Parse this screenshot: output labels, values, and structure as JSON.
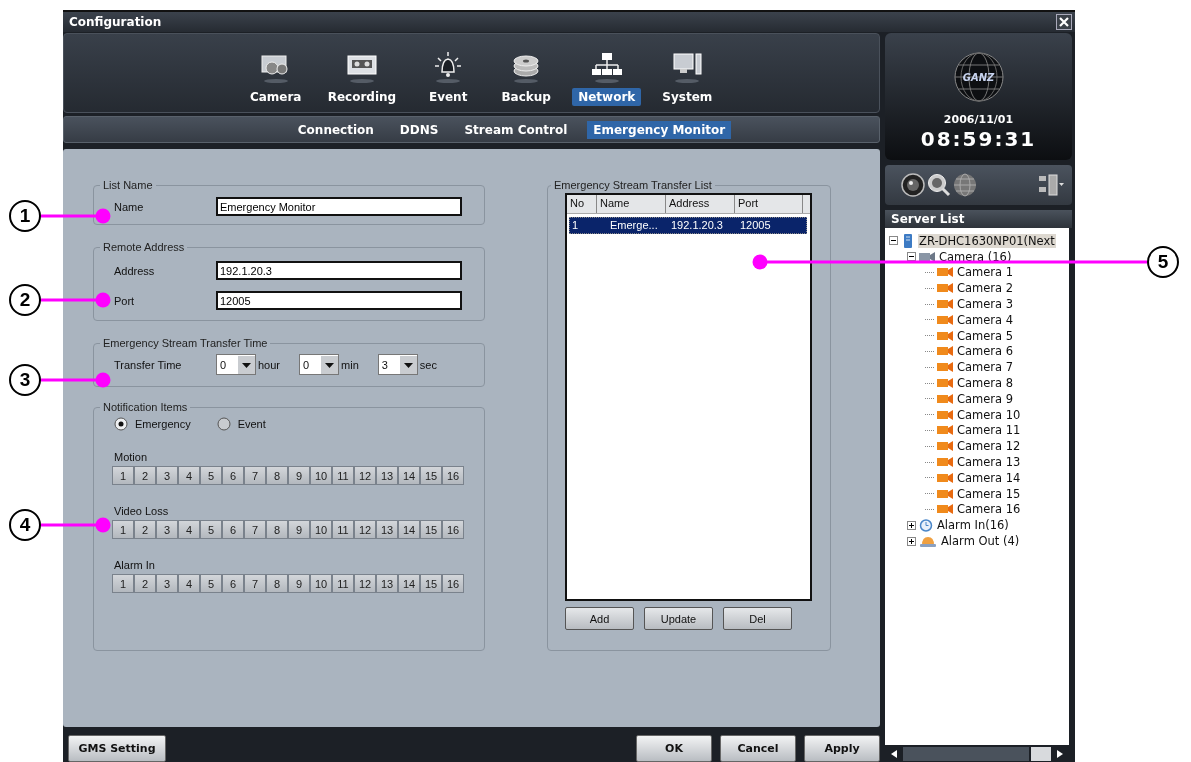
{
  "window": {
    "title": "Configuration"
  },
  "main_tabs": [
    {
      "label": "Camera",
      "selected": false
    },
    {
      "label": "Recording",
      "selected": false
    },
    {
      "label": "Event",
      "selected": false
    },
    {
      "label": "Backup",
      "selected": false
    },
    {
      "label": "Network",
      "selected": true
    },
    {
      "label": "System",
      "selected": false
    }
  ],
  "sub_tabs": [
    {
      "label": "Connection",
      "selected": false
    },
    {
      "label": "DDNS",
      "selected": false
    },
    {
      "label": "Stream Control",
      "selected": false
    },
    {
      "label": "Emergency Monitor",
      "selected": true
    }
  ],
  "list_name": {
    "legend": "List Name",
    "name_label": "Name",
    "name_value": "Emergency Monitor"
  },
  "remote_address": {
    "legend": "Remote Address",
    "address_label": "Address",
    "address_value": "192.1.20.3",
    "port_label": "Port",
    "port_value": "12005"
  },
  "transfer_time": {
    "legend": "Emergency Stream Transfer Time",
    "label": "Transfer Time",
    "fields": [
      {
        "value": "0",
        "unit": "hour"
      },
      {
        "value": "0",
        "unit": "min"
      },
      {
        "value": "3",
        "unit": "sec"
      }
    ]
  },
  "notification": {
    "legend": "Notification Items",
    "modes": [
      {
        "label": "Emergency",
        "selected": true
      },
      {
        "label": "Event",
        "selected": false
      }
    ],
    "groups": [
      {
        "label": "Motion",
        "channels": [
          "1",
          "2",
          "3",
          "4",
          "5",
          "6",
          "7",
          "8",
          "9",
          "10",
          "11",
          "12",
          "13",
          "14",
          "15",
          "16"
        ]
      },
      {
        "label": "Video Loss",
        "channels": [
          "1",
          "2",
          "3",
          "4",
          "5",
          "6",
          "7",
          "8",
          "9",
          "10",
          "11",
          "12",
          "13",
          "14",
          "15",
          "16"
        ]
      },
      {
        "label": "Alarm In",
        "channels": [
          "1",
          "2",
          "3",
          "4",
          "5",
          "6",
          "7",
          "8",
          "9",
          "10",
          "11",
          "12",
          "13",
          "14",
          "15",
          "16"
        ]
      }
    ]
  },
  "transfer_list": {
    "legend": "Emergency Stream Transfer List",
    "columns": [
      "No",
      "Name",
      "Address",
      "Port"
    ],
    "rows": [
      {
        "cells": [
          "1",
          "Emerge...",
          "192.1.20.3",
          "12005"
        ],
        "selected": true
      }
    ],
    "buttons": [
      "Add",
      "Update",
      "Del"
    ]
  },
  "footer": {
    "left_button": "GMS Setting",
    "buttons": [
      "OK",
      "Cancel",
      "Apply"
    ]
  },
  "clock": {
    "logo": "GANZ",
    "date": "2006/11/01",
    "time": "08:59:31"
  },
  "server_list": {
    "title": "Server List",
    "tree": [
      {
        "label": "ZR-DHC1630NP01(Next",
        "kind": "server",
        "expanded": true,
        "selected": true,
        "children": [
          {
            "label": "Camera (16)",
            "kind": "camera-group",
            "expanded": true,
            "selected": false,
            "children": [
              {
                "label": "Camera 1",
                "kind": "camera",
                "selected": false
              },
              {
                "label": "Camera 2",
                "kind": "camera",
                "selected": false
              },
              {
                "label": "Camera 3",
                "kind": "camera",
                "selected": false
              },
              {
                "label": "Camera 4",
                "kind": "camera",
                "selected": false
              },
              {
                "label": "Camera 5",
                "kind": "camera",
                "selected": false
              },
              {
                "label": "Camera 6",
                "kind": "camera",
                "selected": false
              },
              {
                "label": "Camera 7",
                "kind": "camera",
                "selected": false
              },
              {
                "label": "Camera 8",
                "kind": "camera",
                "selected": false
              },
              {
                "label": "Camera 9",
                "kind": "camera",
                "selected": false
              },
              {
                "label": "Camera 10",
                "kind": "camera",
                "selected": false
              },
              {
                "label": "Camera 11",
                "kind": "camera",
                "selected": false
              },
              {
                "label": "Camera 12",
                "kind": "camera",
                "selected": false
              },
              {
                "label": "Camera 13",
                "kind": "camera",
                "selected": false
              },
              {
                "label": "Camera 14",
                "kind": "camera",
                "selected": false
              },
              {
                "label": "Camera 15",
                "kind": "camera",
                "selected": false
              },
              {
                "label": "Camera 16",
                "kind": "camera",
                "selected": false
              }
            ]
          },
          {
            "label": "Alarm In(16)",
            "kind": "alarm-in",
            "expanded": false,
            "selected": false
          },
          {
            "label": "Alarm Out (4)",
            "kind": "alarm-out",
            "expanded": false,
            "selected": false
          }
        ]
      }
    ]
  },
  "callouts": [
    {
      "number": "1"
    },
    {
      "number": "2"
    },
    {
      "number": "3"
    },
    {
      "number": "4"
    },
    {
      "number": "5"
    }
  ]
}
